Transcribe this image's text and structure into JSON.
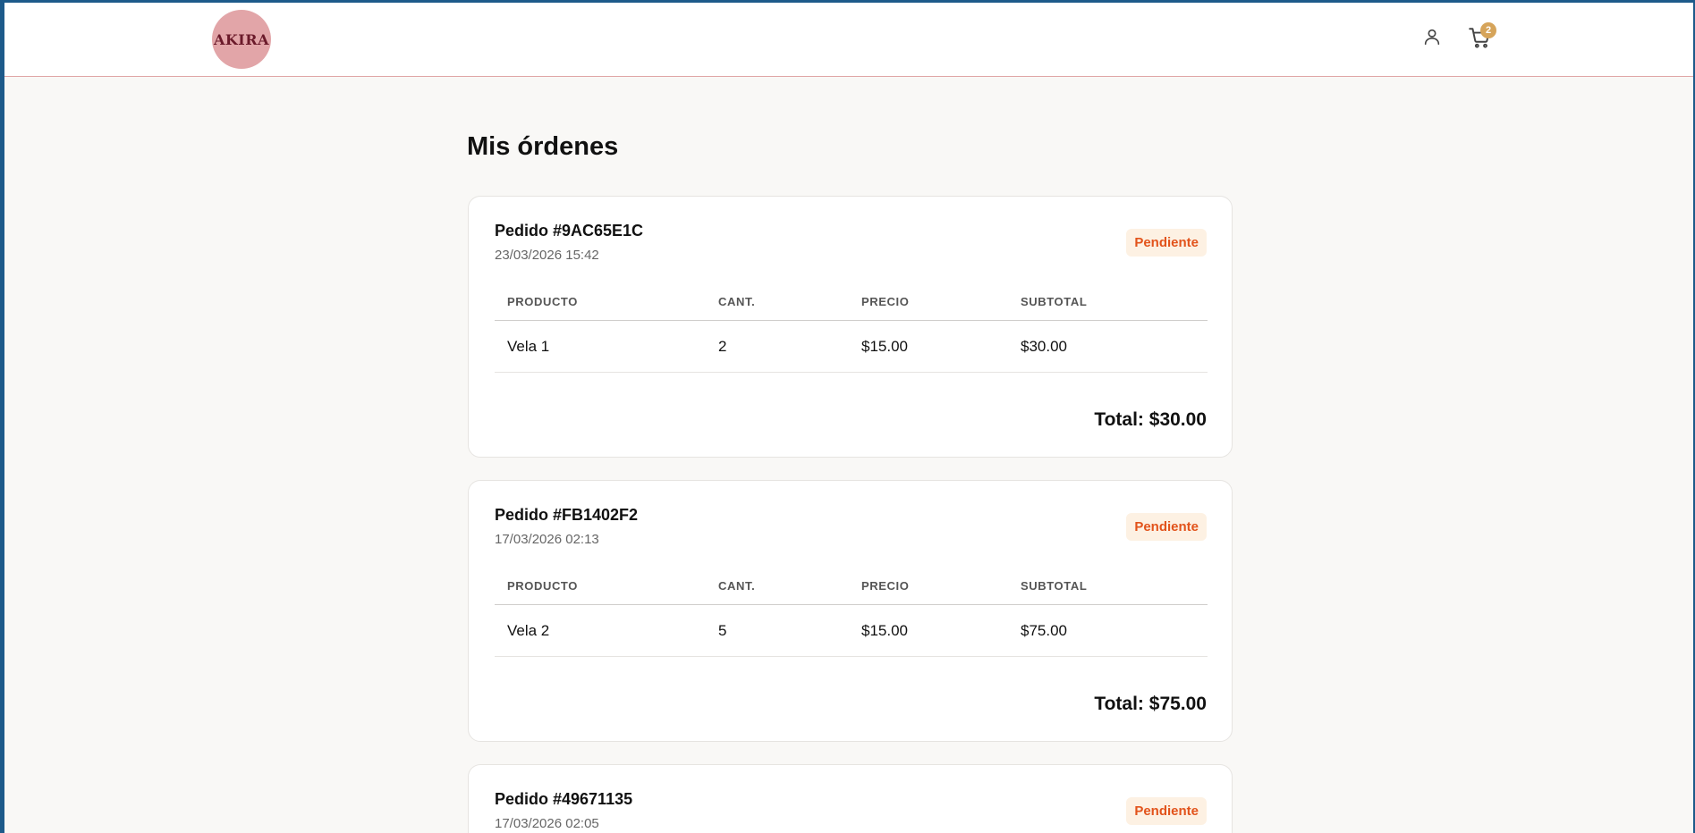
{
  "header": {
    "logo_text": "AKIRA",
    "user_icon": "user-icon",
    "cart_icon": "cart-icon",
    "cart_count": "2"
  },
  "page": {
    "title": "Mis órdenes"
  },
  "table_headers": {
    "product": "PRODUCTO",
    "qty": "CANT.",
    "price": "PRECIO",
    "subtotal": "SUBTOTAL"
  },
  "orders": [
    {
      "id": "Pedido #9AC65E1C",
      "date": "23/03/2026 15:42",
      "status": "Pendiente",
      "items": [
        {
          "product": "Vela 1",
          "qty": "2",
          "price": "$15.00",
          "subtotal": "$30.00"
        }
      ],
      "total": "Total: $30.00"
    },
    {
      "id": "Pedido #FB1402F2",
      "date": "17/03/2026 02:13",
      "status": "Pendiente",
      "items": [
        {
          "product": "Vela 2",
          "qty": "5",
          "price": "$15.00",
          "subtotal": "$75.00"
        }
      ],
      "total": "Total: $75.00"
    },
    {
      "id": "Pedido #49671135",
      "date": "17/03/2026 02:05",
      "status": "Pendiente"
    }
  ],
  "colors": {
    "accent": "#e2a5a8",
    "status_bg": "#fdf1e3",
    "status_text": "#e2531b",
    "badge": "#d6a45a"
  }
}
